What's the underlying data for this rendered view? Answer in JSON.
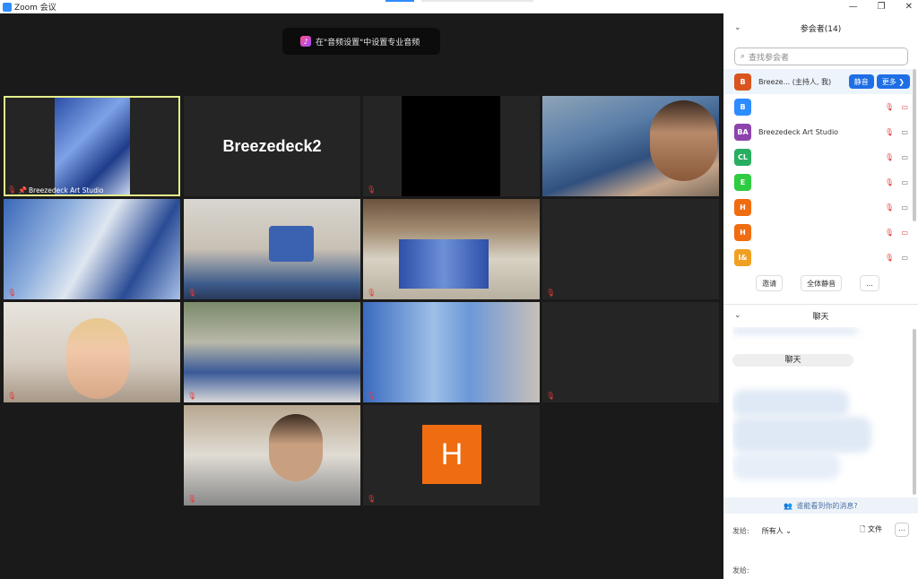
{
  "window": {
    "title": "Zoom 会议",
    "min": "—",
    "restore": "❐",
    "close": "✕"
  },
  "notice": {
    "icon": "music-note-icon",
    "text": "在\"音频设置\"中设置专业音频"
  },
  "tiles": [
    {
      "name": "Breezedeck Art Studio"
    },
    {
      "name": "Breezedeck2"
    },
    {
      "name": "H"
    }
  ],
  "panel": {
    "participants_title": "参会者(14)",
    "search_placeholder": "查找参会者",
    "participants": [
      {
        "initials": "B",
        "color": "#d9541e",
        "name": "Breeze...  (主持人, 我)"
      },
      {
        "initials": "B",
        "color": "#2d8cff",
        "name": ""
      },
      {
        "initials": "BA",
        "color": "#8e44ad",
        "name": "Breezedeck Art Studio"
      },
      {
        "initials": "CL",
        "color": "#27ae60",
        "name": ""
      },
      {
        "initials": "E",
        "color": "#2ecc40",
        "name": ""
      },
      {
        "initials": "H",
        "color": "#f06c11",
        "name": ""
      },
      {
        "initials": "H",
        "color": "#f06c11",
        "name": ""
      },
      {
        "initials": "I&",
        "color": "#f0a020",
        "name": ""
      }
    ],
    "mute_btn": "静音",
    "more_btn": "更多 ❯",
    "invite_btn": "邀请",
    "mute_all_btn": "全体静音",
    "overflow_btn": "...",
    "chat_title": "聊天",
    "chat_bubble": "聊天",
    "who_can_see": "谁能看到你的消息?",
    "to_label": "发给:",
    "to_value": "所有人 ⌄",
    "file_label": "文件",
    "to_label_2": "发给:"
  }
}
